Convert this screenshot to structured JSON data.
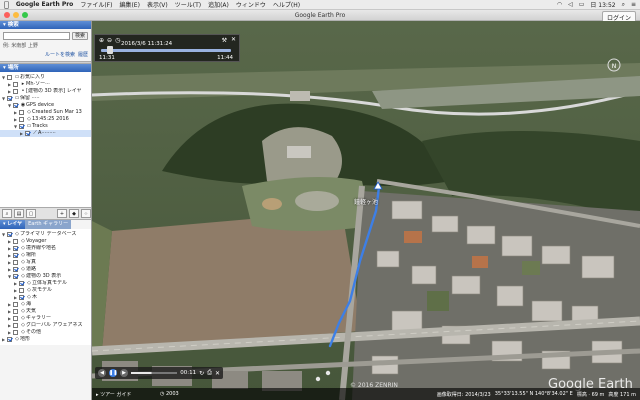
{
  "menubar": {
    "app": "Google Earth Pro",
    "items": [
      "ファイル(F)",
      "編集(E)",
      "表示(V)",
      "ツール(T)",
      "追加(A)",
      "ウィンドウ",
      "ヘルプ(H)"
    ],
    "clock": "日 13:52"
  },
  "window": {
    "title": "Google Earth Pro",
    "login": "ログイン"
  },
  "sidebar": {
    "search": {
      "header": "検索",
      "button": "検索",
      "hint": "例: 米南部 上野",
      "route": "ルートを検索",
      "history": "履歴"
    },
    "places": {
      "header": "場所",
      "items": [
        {
          "label": "お気に入り",
          "level": 0,
          "expanded": true,
          "checked": false,
          "icon": "folder-icon"
        },
        {
          "label": "Mh·ソー···",
          "level": 1,
          "expanded": false,
          "checked": false,
          "icon": "tour-icon"
        },
        {
          "label": "[建物の 3D 表示] レイヤ",
          "level": 1,
          "expanded": false,
          "checked": false,
          "icon": "pin-icon"
        },
        {
          "label": "保留 ·····",
          "level": 0,
          "expanded": true,
          "checked": true,
          "icon": "folder-icon"
        },
        {
          "label": "GPS device",
          "level": 1,
          "expanded": true,
          "checked": true,
          "icon": "gps-icon"
        },
        {
          "label": "Created Sun Mar 13",
          "level": 2,
          "expanded": false,
          "checked": false,
          "icon": ""
        },
        {
          "label": "13:45:25 2016",
          "level": 2,
          "expanded": false,
          "checked": false,
          "icon": ""
        },
        {
          "label": "Tracks",
          "level": 2,
          "expanded": true,
          "checked": true,
          "icon": "folder-icon"
        },
        {
          "label": "A·········",
          "level": 3,
          "expanded": false,
          "checked": true,
          "icon": "track-icon"
        }
      ]
    },
    "layers": {
      "tab_layers": "レイヤ",
      "tab_gallery": "Earth ギャラリー",
      "items": [
        {
          "label": "プライマリ データベース",
          "level": 0,
          "checked": true,
          "expanded": true
        },
        {
          "label": "Voyager",
          "level": 1,
          "checked": false,
          "expanded": false
        },
        {
          "label": "境界線や地名",
          "level": 1,
          "checked": true,
          "expanded": false
        },
        {
          "label": "場所",
          "level": 1,
          "checked": true,
          "expanded": false
        },
        {
          "label": "写真",
          "level": 1,
          "checked": false,
          "expanded": false
        },
        {
          "label": "道路",
          "level": 1,
          "checked": true,
          "expanded": false
        },
        {
          "label": "建物の 3D 表示",
          "level": 1,
          "checked": true,
          "expanded": true
        },
        {
          "label": "立体写真モデル",
          "level": 2,
          "checked": true,
          "expanded": false
        },
        {
          "label": "灰モデル",
          "level": 2,
          "checked": false,
          "expanded": false
        },
        {
          "label": "木",
          "level": 2,
          "checked": true,
          "expanded": false
        },
        {
          "label": "海",
          "level": 1,
          "checked": false,
          "expanded": false
        },
        {
          "label": "天気",
          "level": 1,
          "checked": false,
          "expanded": false
        },
        {
          "label": "ギャラリー",
          "level": 1,
          "checked": false,
          "expanded": false
        },
        {
          "label": "グローバル アウェアネス",
          "level": 1,
          "checked": false,
          "expanded": false
        },
        {
          "label": "その他",
          "level": 1,
          "checked": false,
          "expanded": false
        },
        {
          "label": "地形",
          "level": 0,
          "checked": true,
          "expanded": false
        }
      ]
    }
  },
  "player": {
    "date": "2016/3/6  11:31:24",
    "start": "11:31",
    "end": "11:44",
    "progress": 0.05
  },
  "tourbar": {
    "time": "00:11",
    "progress": 0.45
  },
  "map": {
    "place_label": "鐘軽ヶ池",
    "copyright": "© 2016 ZENRIN",
    "watermark": "Google Earth"
  },
  "status": {
    "tour_guide": "ツアー ガイド",
    "year": "2003",
    "image_date": "画像取得日: 2014/3/23",
    "coords": "35°33'13.55\" N 140°8'34.02\" E",
    "elev": "標高 · 69 m",
    "eye": "高度 171 m"
  },
  "colors": {
    "accent": "#2f64b8",
    "track": "#3d7fe6",
    "sidebar_bg": "#f4f4f4"
  }
}
